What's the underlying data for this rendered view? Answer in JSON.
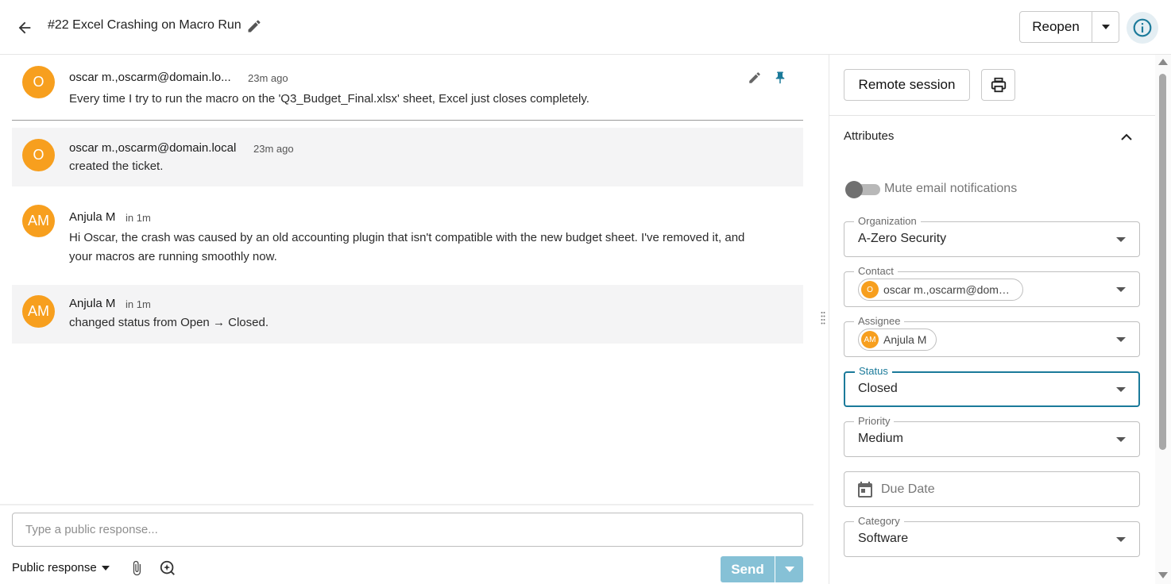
{
  "header": {
    "title": "#22 Excel Crashing on Macro Run",
    "reopen_label": "Reopen",
    "icons": {
      "back": "arrow-left-icon",
      "edit": "pencil-icon",
      "dropdown": "caret-down-icon",
      "info": "info-icon"
    },
    "accent_color": "#1b7a9a"
  },
  "messages": [
    {
      "avatar": "O",
      "author": "oscar m.,oscarm@domain.lo...",
      "time": "23m ago",
      "body": "Every time I try to run the macro on the 'Q3_Budget_Final.xlsx' sheet, Excel just closes completely.",
      "icons": [
        "pencil-icon",
        "pin-icon"
      ]
    },
    {
      "avatar": "O",
      "author": "oscar m.,oscarm@domain.local",
      "time": "23m ago",
      "body": "created the ticket."
    },
    {
      "avatar": "AM",
      "author": "Anjula M",
      "time": "in 1m",
      "body_line1": "Hi Oscar, the crash was caused by an old accounting plugin that isn't compatible with the new budget sheet. I've removed it, and",
      "body_line2": "your macros are running smoothly now."
    },
    {
      "avatar": "AM",
      "author": "Anjula M",
      "time": "in 1m",
      "body_prefix": "changed status from ",
      "from_status": "Open",
      "arrow": " → ",
      "to_status": "Closed",
      "body_suffix": "."
    }
  ],
  "composer": {
    "placeholder": "Type a public response...",
    "response_type": "Public response",
    "send_label": "Send",
    "icons": [
      "paperclip-icon",
      "ai-assist-icon"
    ],
    "send_color": "#86c1d6"
  },
  "sidebar": {
    "remote_session_label": "Remote session",
    "print_icon": "printer-icon",
    "attributes_title": "Attributes",
    "mute_label": "Mute email notifications",
    "mute_enabled": false,
    "fields": {
      "organization": {
        "label": "Organization",
        "value": "A-Zero Security"
      },
      "contact": {
        "label": "Contact",
        "avatar": "O",
        "value": "oscar m.,oscarm@doma..."
      },
      "assignee": {
        "label": "Assignee",
        "avatar": "AM",
        "value": "Anjula M"
      },
      "status": {
        "label": "Status",
        "value": "Closed"
      },
      "priority": {
        "label": "Priority",
        "value": "Medium"
      },
      "due_date": {
        "placeholder": "Due Date"
      },
      "category": {
        "label": "Category",
        "value": "Software"
      }
    },
    "avatar_color": "#f79f1e"
  }
}
